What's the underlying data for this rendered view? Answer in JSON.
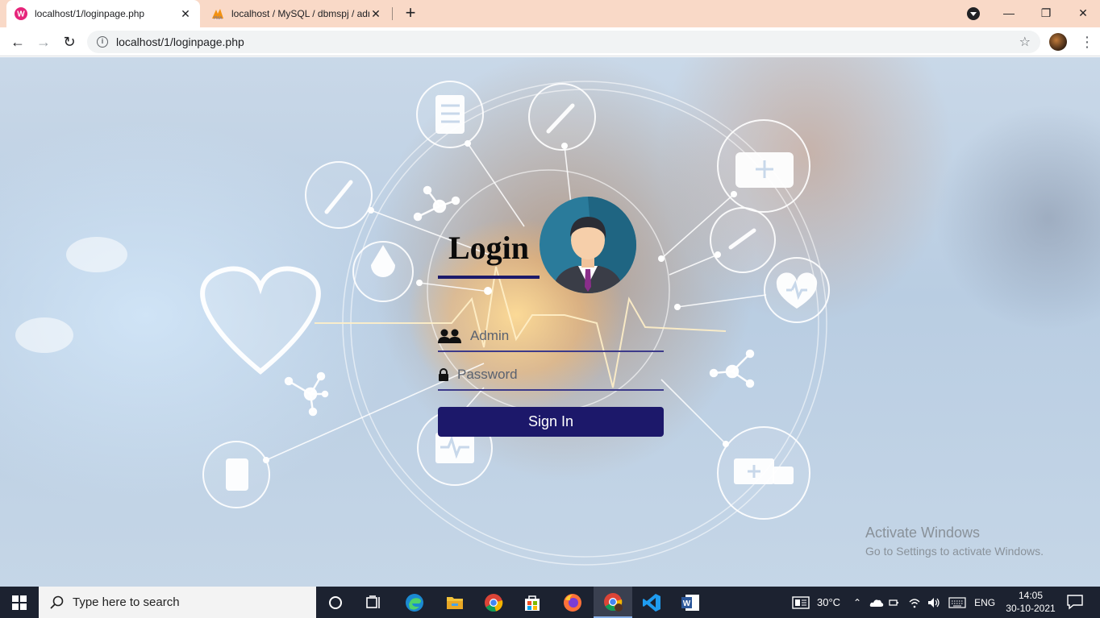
{
  "browser": {
    "tabs": [
      {
        "title": "localhost/1/loginpage.php",
        "active": true
      },
      {
        "title": "localhost / MySQL / dbmspj / adm",
        "active": false
      }
    ],
    "address": "localhost/1/loginpage.php",
    "window_controls": {
      "minimize": "—",
      "restore": "❐",
      "close": "✕"
    }
  },
  "page": {
    "title": "Login",
    "username_placeholder": "Admin",
    "password_placeholder": "Password",
    "signin_label": "Sign In",
    "accent_color": "#1c186a"
  },
  "watermark": {
    "line1": "Activate Windows",
    "line2": "Go to Settings to activate Windows."
  },
  "taskbar": {
    "search_placeholder": "Type here to search",
    "weather": "30°C",
    "language": "ENG",
    "time": "14:05",
    "date": "30-10-2021",
    "apps": [
      "cortana-icon",
      "task-view-icon",
      "edge-icon",
      "file-explorer-icon",
      "chrome-icon",
      "store-icon",
      "firefox-icon",
      "chrome-active-icon",
      "vscode-icon",
      "word-icon"
    ]
  }
}
